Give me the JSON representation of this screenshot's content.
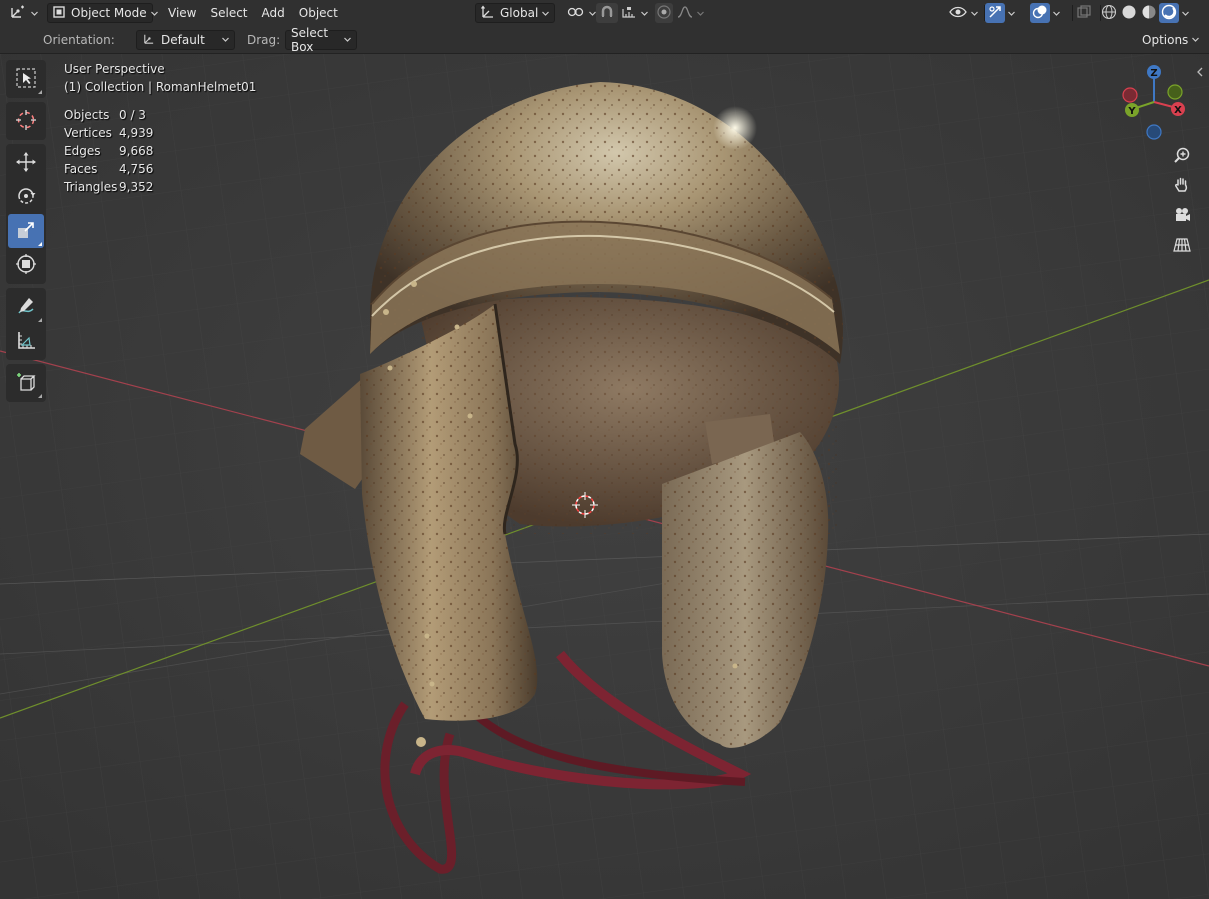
{
  "header": {
    "editor_type_icon": "viewport-3d-icon",
    "mode": "Object Mode",
    "menus": [
      "View",
      "Select",
      "Add",
      "Object"
    ],
    "transform_orientation": "Global",
    "pivot_icon": "pivot-icon",
    "snap_icon": "snap-icon",
    "snap_target_icon": "snap-target-icon",
    "proportional_icon": "proportional-edit-icon",
    "falloff_icon": "falloff-icon",
    "visibility_icon": "visibility-icon",
    "gizmo_icon": "gizmo-icon",
    "overlay_icon": "overlay-icon",
    "xray_icon": "xray-icon",
    "shading_modes": [
      "wireframe",
      "solid",
      "material-preview",
      "rendered"
    ],
    "active_shading": "rendered",
    "accent_color": "#4772b3"
  },
  "tool_settings": {
    "orientation_label": "Orientation:",
    "orientation_value": "Default",
    "drag_label": "Drag:",
    "drag_value": "Select Box",
    "options_label": "Options"
  },
  "toolbar": {
    "tools": [
      "select-box",
      "cursor",
      "move",
      "rotate",
      "scale",
      "transform",
      "annotate",
      "measure",
      "add-cube"
    ],
    "active_tool": "scale"
  },
  "viewport": {
    "perspective": "User Perspective",
    "collection": "(1) Collection | RomanHelmet01",
    "stats": [
      {
        "label": "Objects",
        "value": "0 / 3"
      },
      {
        "label": "Vertices",
        "value": "4,939"
      },
      {
        "label": "Edges",
        "value": "9,668"
      },
      {
        "label": "Faces",
        "value": "4,756"
      },
      {
        "label": "Triangles",
        "value": "9,352"
      }
    ]
  },
  "gizmo": {
    "axes": {
      "x": "X",
      "y": "Y",
      "z": "Z"
    },
    "colors": {
      "x": "#d9404f",
      "y": "#7aa32a",
      "z": "#3f78c4"
    },
    "nav_icons": [
      "zoom-icon",
      "hand-icon",
      "camera-icon",
      "grid-icon"
    ]
  }
}
